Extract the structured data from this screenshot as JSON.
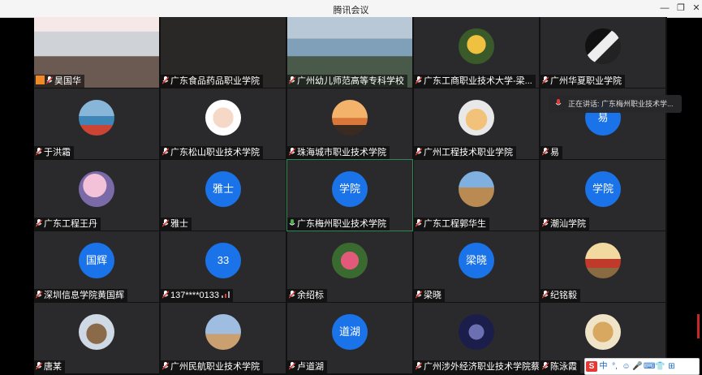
{
  "window": {
    "title": "腾讯会议",
    "min_glyph": "—",
    "max_glyph": "❐",
    "close_glyph": "✕"
  },
  "speaking_now": "正在讲话: 广东梅州职业技术学...",
  "participants": [
    {
      "name": "昊国华",
      "avatar": "video-classroom",
      "host": true
    },
    {
      "name": "广东食品药品职业学院",
      "avatar": "video-dark"
    },
    {
      "name": "广州幼儿师范高等专科学校",
      "avatar": "video-meeting-room"
    },
    {
      "name": "广东工商职业技术大学-梁...",
      "avatar": "photo-yellow-person"
    },
    {
      "name": "广州华夏职业学院",
      "avatar": "photo-dark-bw"
    },
    {
      "name": "于洪霜",
      "avatar": "photo-sea"
    },
    {
      "name": "广东松山职业技术学院",
      "avatar": "photo-baby"
    },
    {
      "name": "珠海城市职业技术学院",
      "avatar": "photo-sunset"
    },
    {
      "name": "广州工程技术职业学院",
      "avatar": "photo-cartoon-family"
    },
    {
      "name": "易",
      "avatar_text": "易"
    },
    {
      "name": "广东工程王丹",
      "avatar": "photo-blossom"
    },
    {
      "name": "雅士",
      "avatar_text": "雅士"
    },
    {
      "name": "广东梅州职业技术学院",
      "avatar_text": "学院",
      "active": true
    },
    {
      "name": "广东工程郭华生",
      "avatar": "photo-desert"
    },
    {
      "name": "潮汕学院",
      "avatar_text": "学院"
    },
    {
      "name": "深圳信息学院黄国辉",
      "avatar_text": "国辉"
    },
    {
      "name": "137****0133",
      "avatar_text": "33",
      "signal": true
    },
    {
      "name": "余绍标",
      "avatar": "photo-flowers"
    },
    {
      "name": "梁晓",
      "avatar_text": "梁晓"
    },
    {
      "name": "纪铭毅",
      "avatar": "photo-desk"
    },
    {
      "name": "唐某",
      "avatar": "photo-dog"
    },
    {
      "name": "广州民航职业技术学院",
      "avatar": "photo-field-person"
    },
    {
      "name": "卢道湖",
      "avatar_text": "道湖"
    },
    {
      "name": "广州涉外经济职业技术学院蔡...",
      "avatar": "photo-hand-night"
    },
    {
      "name": "陈泳霞",
      "avatar": "photo-cartoon-bear"
    }
  ],
  "ime": {
    "logo": "S",
    "mode": "中",
    "items": [
      "°,",
      "☺",
      "🎤",
      "⌨",
      "👕",
      "⊞"
    ]
  },
  "colors": {
    "avatar_blue": "#1a73e8",
    "active_border": "#2e8a55",
    "tile_bg": "#2a2a2c"
  }
}
